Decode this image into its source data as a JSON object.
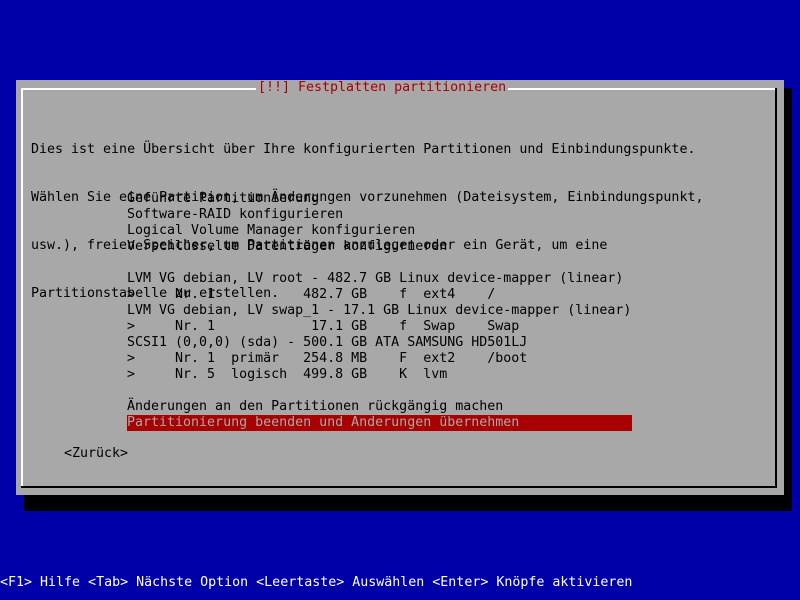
{
  "dialog": {
    "title": "[!!] Festplatten partitionieren",
    "intro": [
      "Dies ist eine Übersicht über Ihre konfigurierten Partitionen und Einbindungspunkte.",
      "Wählen Sie eine Partition, um Änderungen vorzunehmen (Dateisystem, Einbindungspunkt,",
      "usw.), freien Speicher, um Partitionen anzulegen oder ein Gerät, um eine",
      "Partitionstabelle zu erstellen."
    ],
    "menu": [
      "Geführte Partitionierung",
      "Software-RAID konfigurieren",
      "Logical Volume Manager konfigurieren",
      "Verschlüsselte Datenträger konfigurieren"
    ],
    "devices": [
      "LVM VG debian, LV root - 482.7 GB Linux device-mapper (linear)",
      ">     Nr. 1           482.7 GB    f  ext4    /",
      "LVM VG debian, LV swap_1 - 17.1 GB Linux device-mapper (linear)",
      ">     Nr. 1            17.1 GB    f  Swap    Swap",
      "SCSI1 (0,0,0) (sda) - 500.1 GB ATA SAMSUNG HD501LJ",
      ">     Nr. 1  primär   254.8 MB    F  ext2    /boot",
      ">     Nr. 5  logisch  499.8 GB    K  lvm"
    ],
    "actions": [
      "Änderungen an den Partitionen rückgängig machen",
      "Partitionierung beenden und Änderungen übernehmen"
    ],
    "back_label": "<Zurück>"
  },
  "statusbar": "<F1> Hilfe <Tab> Nächste Option <Leertaste> Auswählen <Enter> Knöpfe aktivieren",
  "colors": {
    "background": "#0000a8",
    "dialog": "#a8a8a8",
    "title_text": "#a80000",
    "selection": "#a80000"
  }
}
